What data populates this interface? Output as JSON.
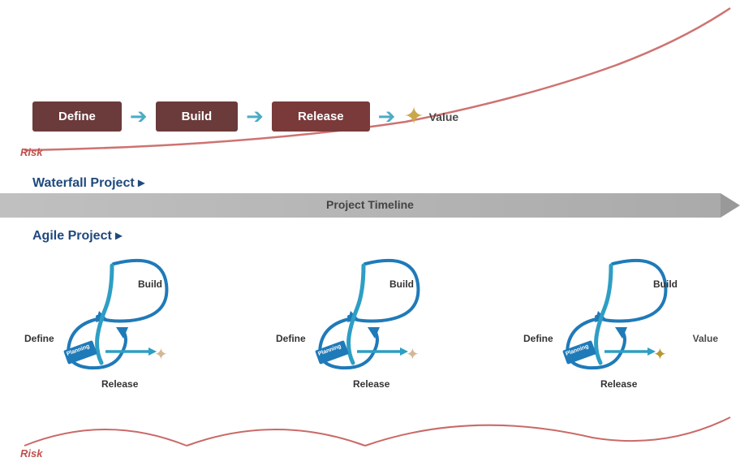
{
  "waterfall": {
    "title": "Waterfall Project ▸",
    "boxes": [
      "Define",
      "Build",
      "Release"
    ],
    "value_label": "Value",
    "risk_label": "Risk",
    "star": "✦"
  },
  "timeline": {
    "label": "Project Timeline"
  },
  "agile": {
    "title": "Agile Project ▸",
    "cycles": [
      {
        "define": "Define",
        "build": "Build",
        "release": "Release",
        "show_value": false
      },
      {
        "define": "Define",
        "build": "Build",
        "release": "Release",
        "show_value": false
      },
      {
        "define": "Define",
        "build": "Build",
        "release": "Release",
        "show_value": true
      }
    ],
    "value_label": "Value",
    "risk_label": "Risk"
  },
  "colors": {
    "box_bg": "#6b3a3a",
    "arrow_blue": "#4bacc6",
    "star_gold": "#c9a84c",
    "risk_red": "#c0504d",
    "title_blue": "#1f497d",
    "cycle_blue": "#2e74b5",
    "cycle_teal": "#17a2b8"
  }
}
